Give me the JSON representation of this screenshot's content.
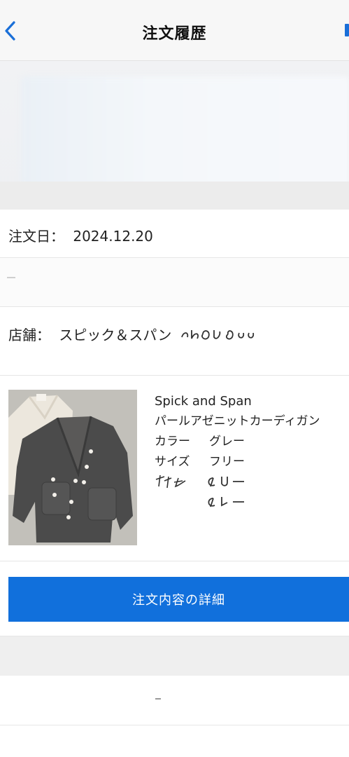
{
  "header": {
    "title": "注文履歴",
    "back_icon": "chevron-left-icon"
  },
  "order": {
    "date_label": "注文日：",
    "date_value": "2024.12.20",
    "store_label": "店舗：",
    "store_value": "スピック＆スパン"
  },
  "product": {
    "brand": "Spick and Span",
    "name": "パールアゼニットカーディガン",
    "color_label": "カラー",
    "color_value": "グレー",
    "size_label": "サイズ",
    "size_value": "フリー"
  },
  "actions": {
    "detail_button": "注文内容の詳細"
  },
  "colors": {
    "accent": "#1170dc",
    "header_bg": "#f7f7f7"
  }
}
